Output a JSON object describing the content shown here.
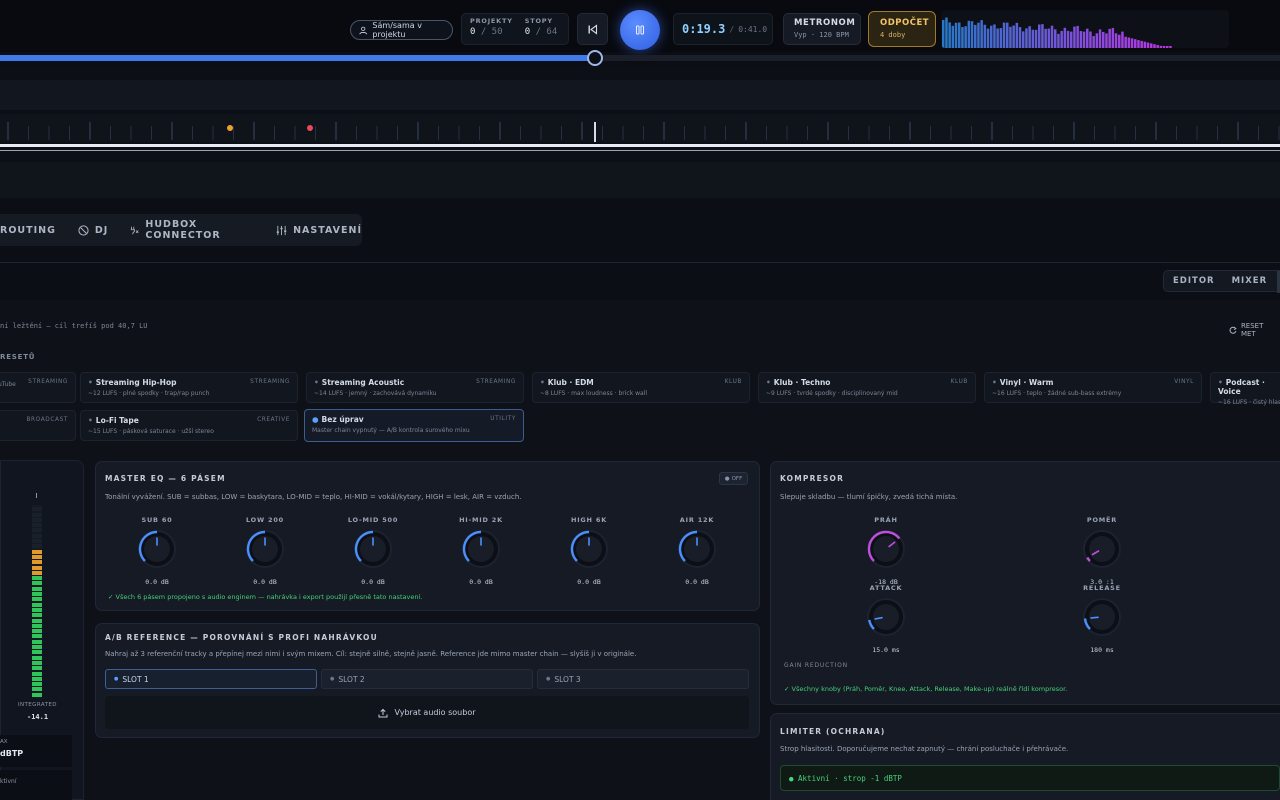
{
  "transport": {
    "collab_label": "Sám/sama v projektu",
    "projects_label": "PROJEKTY",
    "projects_value": "0",
    "projects_max": "/ 50",
    "tracks_label": "STOPY",
    "tracks_value": "0",
    "tracks_max": "/ 64",
    "time_current": "0:19.3",
    "time_sep": "/",
    "time_total": "0:41.0",
    "metronome_title": "METRONOM",
    "metronome_sub": "Vyp · 120 BPM",
    "countin_title": "ODPOČET",
    "countin_sub": "4 doby",
    "progress_fraction": 0.465
  },
  "tabs": [
    {
      "label": "ROUTING",
      "icon": "routing-icon"
    },
    {
      "label": "DJ",
      "icon": "dj-icon"
    },
    {
      "label": "HUDBOX CONNECTOR",
      "icon": "connector-icon"
    },
    {
      "label": "NASTAVENÍ",
      "icon": "sliders-icon"
    }
  ],
  "view_switch": {
    "editor": "EDITOR",
    "mixer": "MIXER"
  },
  "hint": "ní ležtění – cíl trefíš pod 40,7 LU",
  "reset_label": "RESET MET",
  "presets_title": "RESETŮ",
  "presets_row1": [
    {
      "name": "",
      "cat": "STREAMING",
      "desc": "uTube"
    },
    {
      "name": "Streaming Hip-Hop",
      "cat": "STREAMING",
      "desc": "~12 LUFS · plné spodky · trap/rap punch"
    },
    {
      "name": "Streaming Acoustic",
      "cat": "STREAMING",
      "desc": "~14 LUFS · jemný · zachovává dynamiku"
    },
    {
      "name": "Klub · EDM",
      "cat": "KLUB",
      "desc": "~8 LUFS · max loudness · brick wall"
    },
    {
      "name": "Klub · Techno",
      "cat": "KLUB",
      "desc": "~9 LUFS · tvrdé spodky · disciplinovaný mid"
    },
    {
      "name": "Vinyl · Warm",
      "cat": "VINYL",
      "desc": "~16 LUFS · teplo · žádné sub-bass extrémy"
    },
    {
      "name": "Podcast · Voice",
      "cat": "",
      "desc": "~16 LUFS · čistý hlas"
    }
  ],
  "presets_row2": [
    {
      "name": "",
      "cat": "BROADCAST",
      "desc": ""
    },
    {
      "name": "Lo-Fi Tape",
      "cat": "CREATIVE",
      "desc": "~15 LUFS · pásková saturace · užší stereo"
    },
    {
      "name": "Bez úprav",
      "cat": "UTILITY",
      "desc": "Master chain vypnutý — A/B kontrola surového mixu"
    }
  ],
  "meter": {
    "level_fraction": 0.78,
    "integrated_label": "INTEGRATED",
    "integrated_value": "-14.1",
    "max_label": "AX",
    "max_unit": "dBTP",
    "extra_label": "ktivní"
  },
  "eq": {
    "title": "MASTER EQ — 6 PÁSEM",
    "off_label": "OFF",
    "desc": "Tonální vyvážení. SUB = subbas, LOW = baskytara, LO-MID = teplo, HI-MID = vokál/kytary, HIGH = lesk, AIR = vzduch.",
    "bands": [
      {
        "label": "SUB 60",
        "value": "0.0 dB"
      },
      {
        "label": "LOW 200",
        "value": "0.0 dB"
      },
      {
        "label": "LO-MID 500",
        "value": "0.0 dB"
      },
      {
        "label": "HI-MID 2K",
        "value": "0.0 dB"
      },
      {
        "label": "HIGH 6K",
        "value": "0.0 dB"
      },
      {
        "label": "AIR 12K",
        "value": "0.0 dB"
      }
    ],
    "ok": "✓ Všech 6 pásem propojeno s audio enginem — nahrávka i export použijí přesně tato nastavení."
  },
  "ab": {
    "title": "A/B REFERENCE — POROVNÁNÍ S PROFI NAHRÁVKOU",
    "desc": "Nahraj až 3 referenční tracky a přepínej mezi nimi i svým mixem. Cíl: stejně silně, stejně jasně. Reference jde mimo master chain — slyšíš ji v originále.",
    "slots": [
      "SLOT 1",
      "SLOT 2",
      "SLOT 3"
    ],
    "upload_label": "Vybrat audio soubor"
  },
  "compressor": {
    "title": "KOMPRESOR",
    "desc": "Slepuje skladbu — tlumí špičky, zvedá tichá místa.",
    "threshold_label": "PRÁH",
    "threshold_value": "-18 dB",
    "ratio_label": "POMĚR",
    "ratio_value": "3.0 :1",
    "attack_label": "ATTACK",
    "attack_value": "15.0 ms",
    "release_label": "RELEASE",
    "release_value": "180 ms",
    "gr_label": "GAIN REDUCTION",
    "ok": "✓ Všechny knoby (Práh, Poměr, Knee, Attack, Release, Make-up) reálně řídí kompresor."
  },
  "limiter": {
    "title": "LIMITER (OCHRANA)",
    "desc": "Strop hlasitosti. Doporučujeme nechat zapnutý — chrání posluchače i přehrávače.",
    "status": "● Aktivní · strop -1 dBTP"
  },
  "colors": {
    "accent": "#3f7ae8",
    "knob_blue": "#4a90ff",
    "knob_purple": "#c04ee0",
    "ok_green": "#45d07a",
    "countin_gold": "#f2c468"
  }
}
